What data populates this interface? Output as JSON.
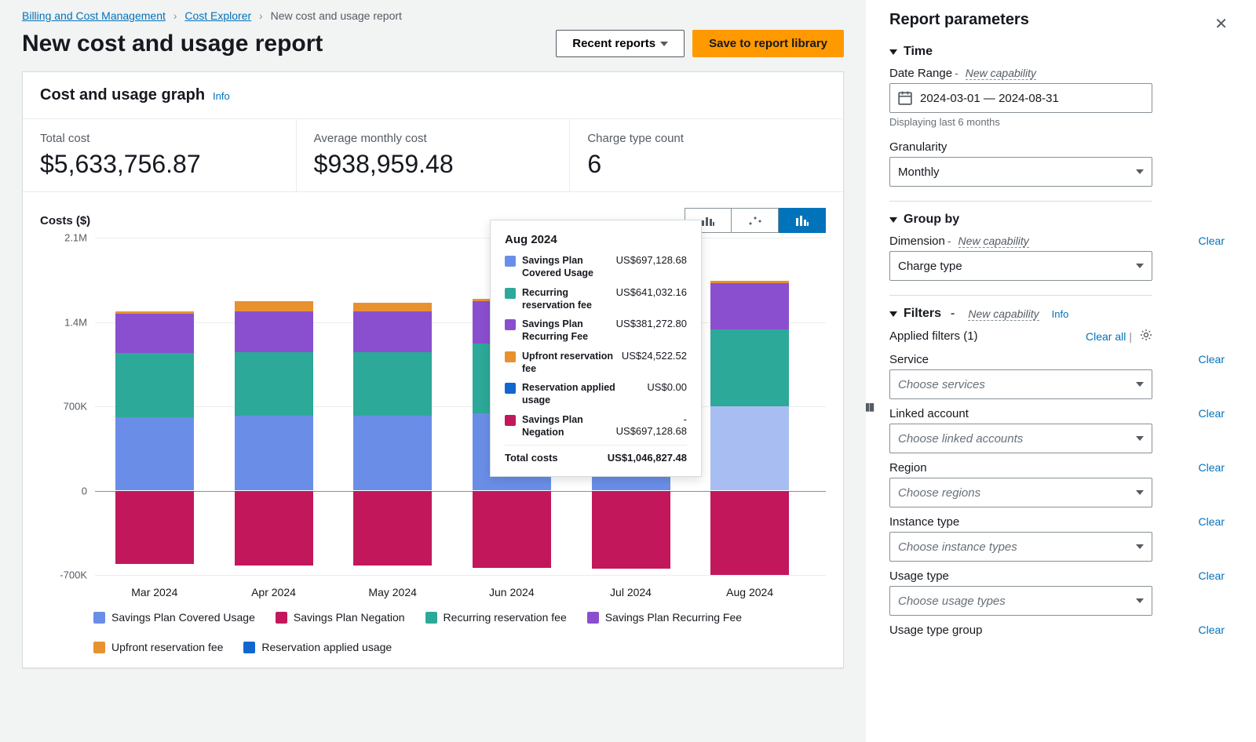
{
  "breadcrumbs": {
    "billing": "Billing and Cost Management",
    "explorer": "Cost Explorer",
    "current": "New cost and usage report"
  },
  "page_title": "New cost and usage report",
  "buttons": {
    "recent_reports": "Recent reports",
    "save_report": "Save to report library"
  },
  "card": {
    "title": "Cost and usage graph",
    "info": "Info"
  },
  "metrics": {
    "total_cost_label": "Total cost",
    "total_cost_value": "$5,633,756.87",
    "avg_label": "Average monthly cost",
    "avg_value": "$938,959.48",
    "ctc_label": "Charge type count",
    "ctc_value": "6"
  },
  "chart_axis_title": "Costs ($)",
  "chart_data": {
    "type": "bar",
    "ylabel": "Costs ($)",
    "ylim": [
      -700000,
      2100000
    ],
    "y_ticks": [
      "2.1M",
      "1.4M",
      "700K",
      "0",
      "-700K"
    ],
    "categories": [
      "Mar 2024",
      "Apr 2024",
      "May 2024",
      "Jun 2024",
      "Jul 2024",
      "Aug 2024"
    ],
    "series": [
      {
        "name": "Savings Plan Covered Usage",
        "color": "#6a8ee8",
        "values": [
          610000,
          620000,
          620000,
          640000,
          650000,
          697128
        ]
      },
      {
        "name": "Recurring reservation fee",
        "color": "#2ca999",
        "values": [
          530000,
          530000,
          530000,
          580000,
          590000,
          641032
        ]
      },
      {
        "name": "Savings Plan Recurring Fee",
        "color": "#8a4fcf",
        "values": [
          330000,
          340000,
          340000,
          350000,
          360000,
          381273
        ]
      },
      {
        "name": "Upfront reservation fee",
        "color": "#e8912f",
        "values": [
          20000,
          80000,
          70000,
          20000,
          20000,
          24523
        ]
      },
      {
        "name": "Reservation applied usage",
        "color": "#1166d0",
        "values": [
          0,
          0,
          0,
          0,
          0,
          0
        ]
      },
      {
        "name": "Savings Plan Negation",
        "color": "#c2185b",
        "values": [
          -610000,
          -620000,
          -620000,
          -640000,
          -650000,
          -697128
        ]
      }
    ]
  },
  "tooltip": {
    "month": "Aug 2024",
    "rows": [
      {
        "color": "#6a8ee8",
        "name": "Savings Plan Covered Usage",
        "value": "US$697,128.68"
      },
      {
        "color": "#2ca999",
        "name": "Recurring reservation fee",
        "value": "US$641,032.16"
      },
      {
        "color": "#8a4fcf",
        "name": "Savings Plan Recurring Fee",
        "value": "US$381,272.80"
      },
      {
        "color": "#e8912f",
        "name": "Upfront reservation fee",
        "value": "US$24,522.52"
      },
      {
        "color": "#1166d0",
        "name": "Reservation applied usage",
        "value": "US$0.00"
      },
      {
        "color": "#c2185b",
        "name": "Savings Plan Negation",
        "value": "-\nUS$697,128.68"
      }
    ],
    "total_label": "Total costs",
    "total_value": "US$1,046,827.48"
  },
  "legend": [
    {
      "color": "#6a8ee8",
      "label": "Savings Plan Covered Usage"
    },
    {
      "color": "#c2185b",
      "label": "Savings Plan Negation"
    },
    {
      "color": "#2ca999",
      "label": "Recurring reservation fee"
    },
    {
      "color": "#8a4fcf",
      "label": "Savings Plan Recurring Fee"
    },
    {
      "color": "#e8912f",
      "label": "Upfront reservation fee"
    },
    {
      "color": "#1166d0",
      "label": "Reservation applied usage"
    }
  ],
  "panel": {
    "title": "Report parameters",
    "sections": {
      "time": "Time",
      "groupby": "Group by",
      "filters": "Filters"
    },
    "date_range_label": "Date Range",
    "new_capability": "New capability",
    "date_range_value": "2024-03-01 — 2024-08-31",
    "date_range_hint": "Displaying last 6 months",
    "granularity_label": "Granularity",
    "granularity_value": "Monthly",
    "dimension_label": "Dimension",
    "dimension_value": "Charge type",
    "filters_info": "Info",
    "applied_filters": "Applied filters (1)",
    "clear_all": "Clear all",
    "clear": "Clear",
    "filter_fields": [
      {
        "label": "Service",
        "placeholder": "Choose services"
      },
      {
        "label": "Linked account",
        "placeholder": "Choose linked accounts"
      },
      {
        "label": "Region",
        "placeholder": "Choose regions"
      },
      {
        "label": "Instance type",
        "placeholder": "Choose instance types"
      },
      {
        "label": "Usage type",
        "placeholder": "Choose usage types"
      },
      {
        "label": "Usage type group",
        "placeholder": ""
      }
    ]
  }
}
